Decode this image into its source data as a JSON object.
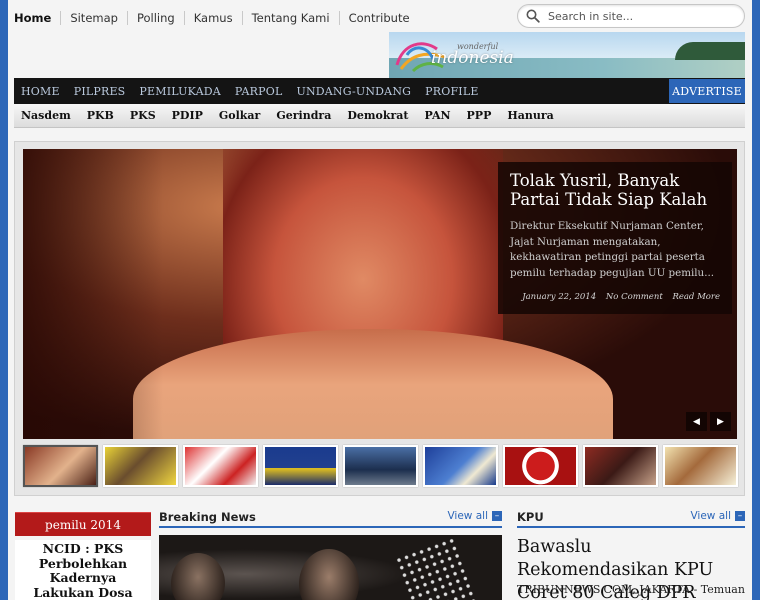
{
  "topnav": {
    "links": [
      "Home",
      "Sitemap",
      "Polling",
      "Kamus",
      "Tentang Kami",
      "Contribute"
    ]
  },
  "search": {
    "placeholder": "Search in site..."
  },
  "banner": {
    "word_small": "wonderful",
    "word_main": "indonesia"
  },
  "mainmenu": {
    "items": [
      "HOME",
      "PILPRES",
      "PEMILUKADA",
      "PARPOL",
      "UNDANG-UNDANG",
      "PROFILE"
    ],
    "advertise": "ADVERTISE"
  },
  "submenu": {
    "items": [
      "Nasdem",
      "PKB",
      "PKS",
      "PDIP",
      "Golkar",
      "Gerindra",
      "Demokrat",
      "PAN",
      "PPP",
      "Hanura"
    ]
  },
  "slider": {
    "title": "Tolak Yusril, Banyak Partai Tidak Siap Kalah",
    "excerpt": "Direktur Eksekutif Nurjaman Center, Jajat Nurjaman mengatakan, kekhawatiran petinggi partai peserta pemilu terhadap pegujian UU pemilu...",
    "date": "January 22, 2014",
    "comments": "No Comment",
    "read_more": "Read More",
    "prev": "◀",
    "next": "▶"
  },
  "pemilu": {
    "header": "pemilu 2014",
    "title": "NCID : PKS Perbolehkan Kadernya Lakukan Dosa"
  },
  "breaking": {
    "header": "Breaking News",
    "view_all": "View all"
  },
  "kpu": {
    "header": "KPU",
    "view_all": "View all",
    "title": "Bawaslu Rekomendasikan KPU Coret 80 Caleg DPR",
    "subtitle": "TRIBUNNEWS.COM, JAKARTA - Temuan"
  },
  "colors": {
    "accent": "#2c66b8",
    "menu_bg": "#141414",
    "pemilu_red": "#b31a1a"
  },
  "icons": [
    "search-icon",
    "wonderful-indonesia-logo",
    "arrow-left-icon",
    "arrow-right-icon",
    "view-all-icon"
  ]
}
